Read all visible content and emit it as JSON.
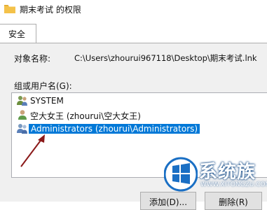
{
  "window": {
    "title": "期末考试 的权限"
  },
  "tabs": [
    {
      "label": "安全"
    }
  ],
  "object": {
    "label": "对象名称:",
    "value": "C:\\Users\\zhourui967118\\Desktop\\期末考试.lnk"
  },
  "group_list": {
    "label": "组或用户名(G):",
    "items": [
      {
        "label": "SYSTEM",
        "icon": "users-group-icon",
        "selected": false
      },
      {
        "label": "空大女王 (zhourui\\空大女王)",
        "icon": "user-icon",
        "selected": false
      },
      {
        "label": "Administrators (zhourui\\Administrators)",
        "icon": "users-group-icon",
        "selected": true
      }
    ]
  },
  "buttons": {
    "add_label": "添加(D)...",
    "remove_label": "删除(R)"
  },
  "watermark": {
    "brand": "系统族",
    "url": "WWW.XITONGZU.COM"
  },
  "colors": {
    "selection": "#0078d7",
    "arrow": "#8b1a1a",
    "watermark_blue": "#1a6fc4"
  }
}
